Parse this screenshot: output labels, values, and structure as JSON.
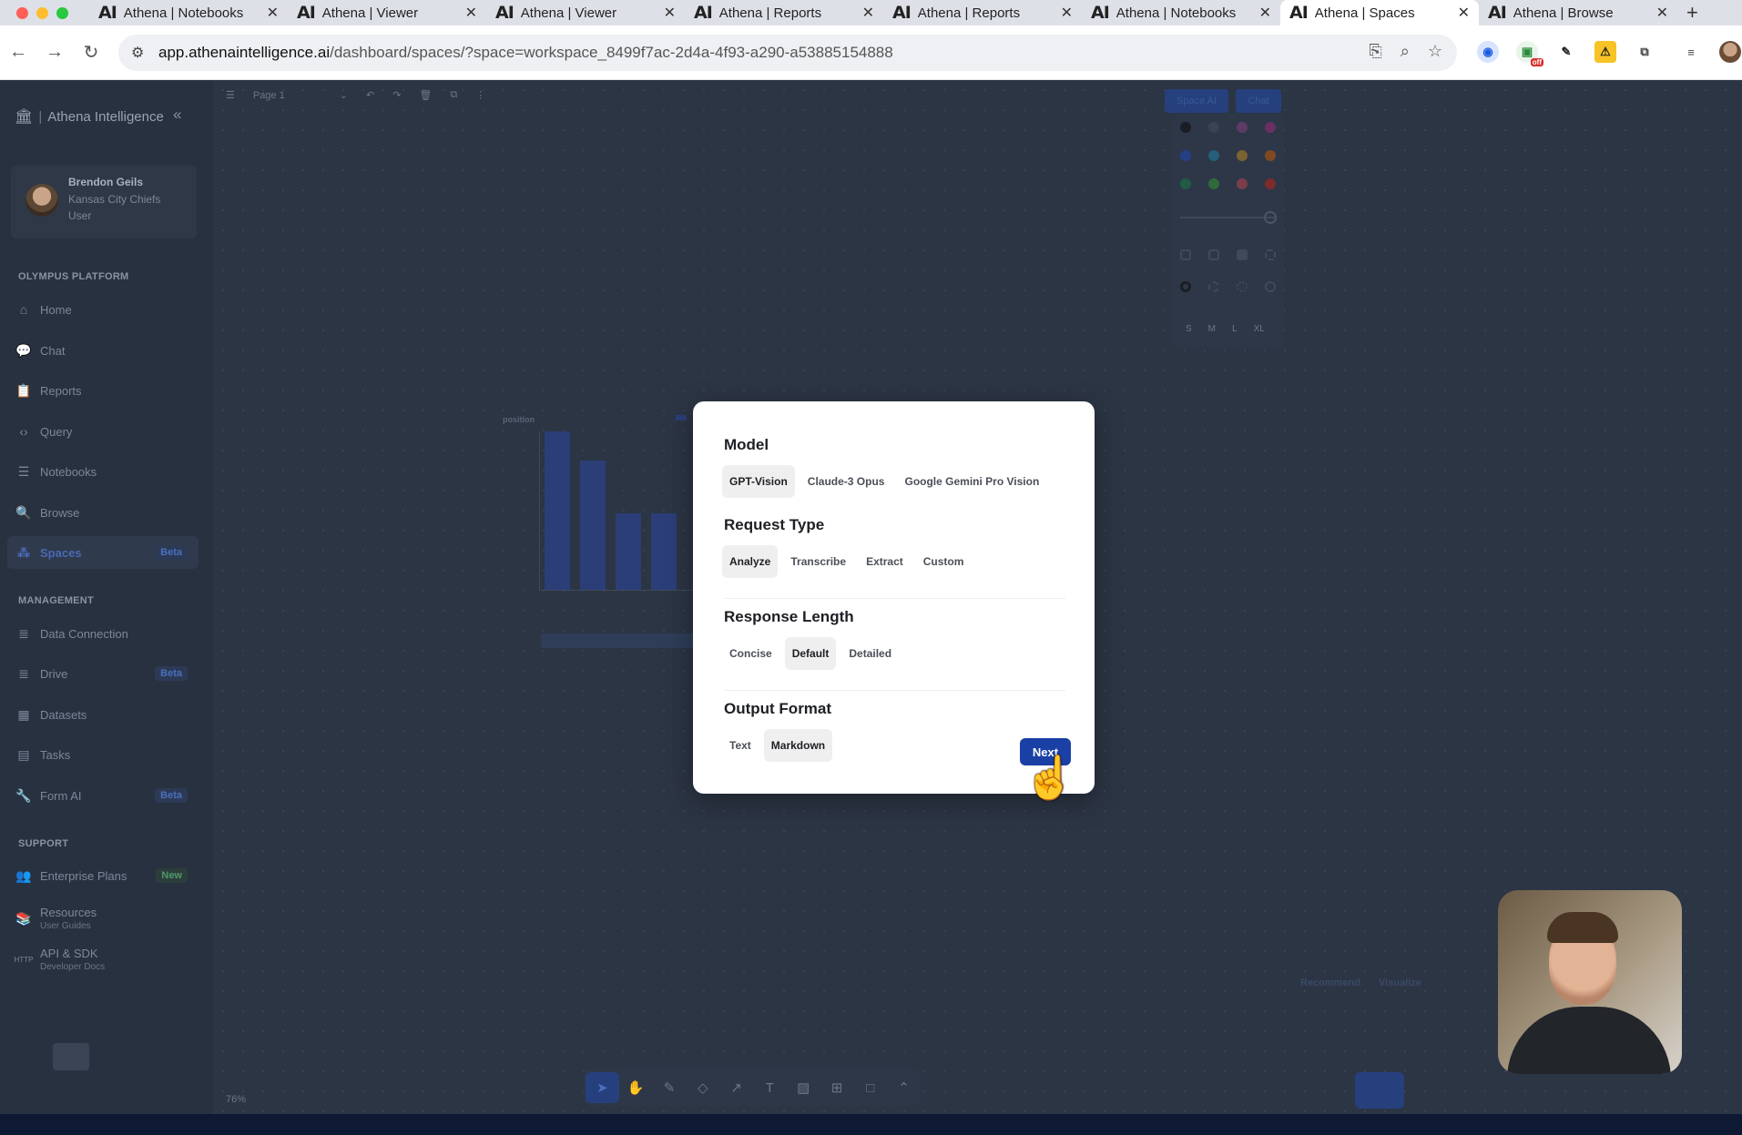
{
  "browser": {
    "tabs": [
      {
        "title": "Athena | Notebooks",
        "active": false
      },
      {
        "title": "Athena | Viewer",
        "active": false
      },
      {
        "title": "Athena | Viewer",
        "active": false
      },
      {
        "title": "Athena | Reports",
        "active": false
      },
      {
        "title": "Athena | Reports",
        "active": false
      },
      {
        "title": "Athena | Notebooks",
        "active": false
      },
      {
        "title": "Athena | Spaces",
        "active": true
      },
      {
        "title": "Athena | Browse",
        "active": false
      }
    ],
    "tab_logo": "AI",
    "url_host": "app.athenaintelligence.ai",
    "url_path": "/dashboard/spaces/?space=workspace_8499f7ac-2d4a-4f93-a290-a53885154888",
    "ext_badge": "off"
  },
  "sidebar": {
    "brand": "Athena Intelligence",
    "user": {
      "name": "Brendon Geils",
      "org": "Kansas City Chiefs",
      "role": "User"
    },
    "sections": {
      "platform": "OLYMPUS PLATFORM",
      "management": "MANAGEMENT",
      "support": "SUPPORT"
    },
    "items": [
      {
        "label": "Home",
        "icon": "home-icon"
      },
      {
        "label": "Chat",
        "icon": "chat-icon"
      },
      {
        "label": "Reports",
        "icon": "clipboard-icon"
      },
      {
        "label": "Query",
        "icon": "code-icon"
      },
      {
        "label": "Notebooks",
        "icon": "list-icon"
      },
      {
        "label": "Browse",
        "icon": "globe-search-icon"
      },
      {
        "label": "Spaces",
        "icon": "spaces-icon",
        "badge": "Beta"
      },
      {
        "label": "Data Connection",
        "icon": "database-icon"
      },
      {
        "label": "Drive",
        "icon": "drive-icon",
        "badge": "Beta"
      },
      {
        "label": "Datasets",
        "icon": "table-icon"
      },
      {
        "label": "Tasks",
        "icon": "document-icon"
      },
      {
        "label": "Form AI",
        "icon": "wrench-icon",
        "badge": "Beta"
      },
      {
        "label": "Enterprise Plans",
        "icon": "team-icon",
        "badge": "New"
      },
      {
        "label": "Resources",
        "sub": "User Guides",
        "icon": "book-icon"
      },
      {
        "label": "API & SDK",
        "sub": "Developer Docs",
        "icon": "http-icon"
      }
    ]
  },
  "canvas": {
    "page_label": "Page 1",
    "space_ai": "Space AI",
    "chat": "Chat",
    "sizes": [
      "S",
      "M",
      "L",
      "XL"
    ],
    "zoom": "76%",
    "chart_label": "position",
    "recommend": "Recommend",
    "visualize": "Visualize"
  },
  "modal": {
    "model": {
      "heading": "Model",
      "options": [
        "GPT-Vision",
        "Claude-3 Opus",
        "Google Gemini Pro Vision"
      ],
      "selected": "GPT-Vision"
    },
    "request_type": {
      "heading": "Request Type",
      "options": [
        "Analyze",
        "Transcribe",
        "Extract",
        "Custom"
      ],
      "selected": "Analyze"
    },
    "response_length": {
      "heading": "Response Length",
      "options": [
        "Concise",
        "Default",
        "Detailed"
      ],
      "selected": "Default"
    },
    "output_format": {
      "heading": "Output Format",
      "options": [
        "Text",
        "Markdown"
      ],
      "selected": "Markdown"
    },
    "next_label": "Next"
  },
  "colors": {
    "accent": "#1a40a6",
    "modal_bg": "#ffffff",
    "overlay": "#2a3342"
  }
}
